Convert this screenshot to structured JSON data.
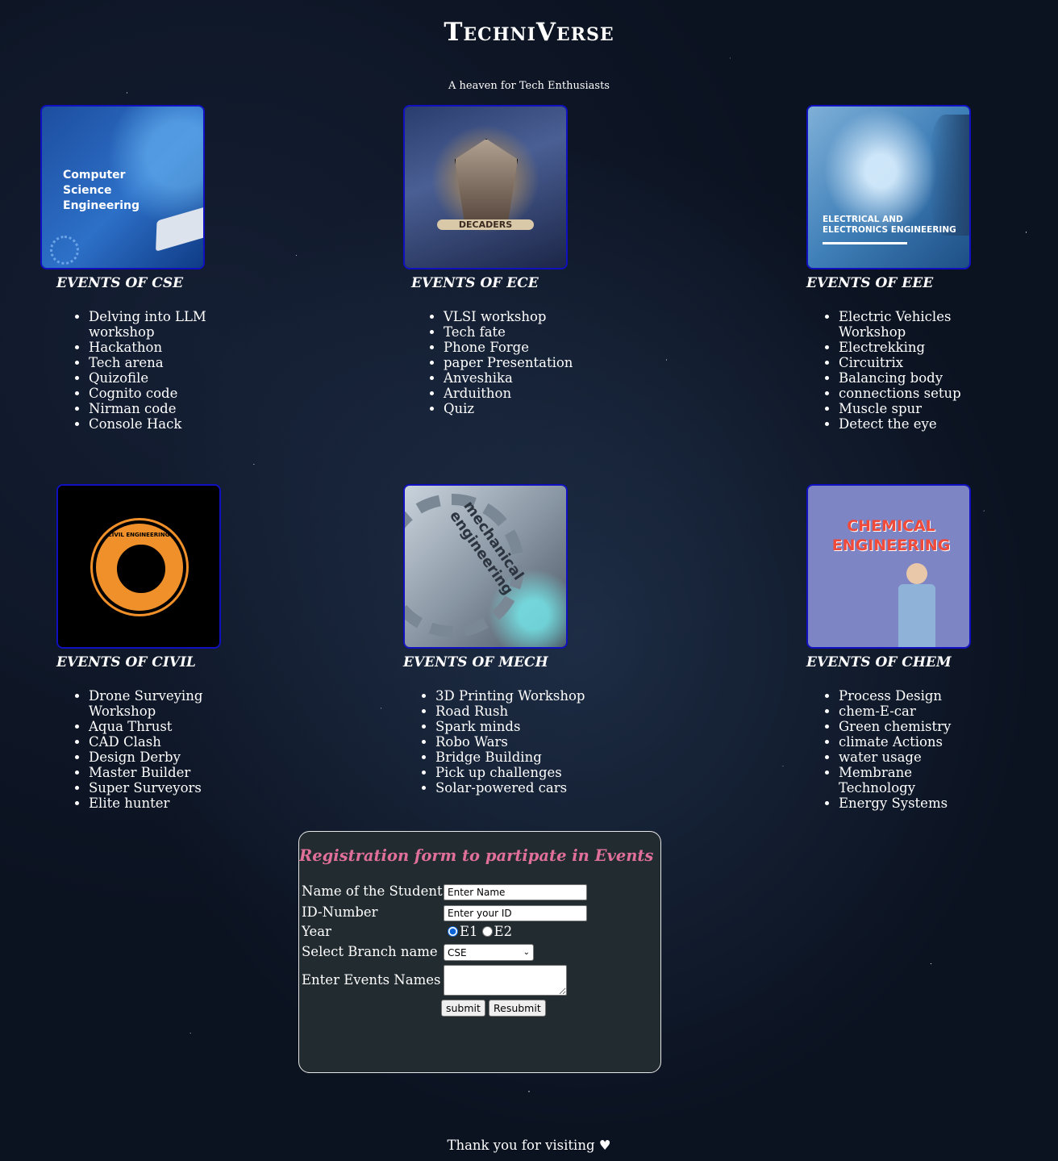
{
  "header": {
    "title": "TechniVerse",
    "tagline": "A heaven for Tech Enthusiasts"
  },
  "departments": [
    {
      "key": "cse",
      "heading": "EVENTS OF CSE",
      "image_caption": "Computer Science Engineering",
      "events": [
        "Delving into LLM workshop",
        "Hackathon",
        "Tech arena",
        "Quizofile",
        "Cognito code",
        "Nirman code",
        "Console Hack"
      ]
    },
    {
      "key": "ece",
      "heading": "EVENTS OF ECE",
      "image_caption": "DECADERS",
      "events": [
        "VLSI workshop",
        "Tech fate",
        "Phone Forge",
        "paper Presentation",
        "Anveshika",
        "Arduithon",
        "Quiz"
      ]
    },
    {
      "key": "eee",
      "heading": "EVENTS OF EEE",
      "image_caption": "ELECTRICAL AND ELECTRONICS ENGINEERING",
      "events": [
        "Electric Vehicles Workshop",
        "Electrekking",
        "Circuitrix",
        "Balancing body",
        "connections setup",
        "Muscle spur",
        "Detect the eye"
      ]
    },
    {
      "key": "civil",
      "heading": "EVENTS OF CIVIL",
      "image_caption": "CIVIL ENGINEERING",
      "events": [
        "Drone Surveying Workshop",
        "Aqua Thrust",
        "CAD Clash",
        "Design Derby",
        "Master Builder",
        "Super Surveyors",
        "Elite hunter"
      ]
    },
    {
      "key": "mech",
      "heading": "EVENTS OF MECH",
      "image_caption": "mechanical engineering",
      "events": [
        "3D Printing Workshop",
        "Road Rush",
        "Spark minds",
        "Robo Wars",
        "Bridge Building",
        "Pick up challenges",
        "Solar-powered cars"
      ]
    },
    {
      "key": "chem",
      "heading": "EVENTS OF CHEM",
      "image_caption": "CHEMICAL ENGINEERING",
      "events": [
        "Process Design",
        "chem-E-car",
        "Green chemistry",
        "climate Actions",
        "water usage",
        "Membrane Technology",
        "Energy Systems"
      ]
    }
  ],
  "form": {
    "title": "Registration form to partipate in Events",
    "name_label": "Name of the Student",
    "name_placeholder": "Enter Name",
    "id_label": "ID-Number",
    "id_placeholder": "Enter your ID",
    "year_label": "Year",
    "year_options": [
      "E1",
      "E2"
    ],
    "year_selected": "E1",
    "branch_label": "Select Branch name",
    "branch_selected": "CSE",
    "events_label": "Enter Events Names",
    "events_value": "",
    "submit_label": "submit",
    "reset_label": "Resubmit"
  },
  "footer": {
    "text": "Thank you for visiting ♥"
  },
  "colors": {
    "image_border": "#1010c0",
    "form_title": "#e0709a",
    "form_background": "#222b30"
  }
}
